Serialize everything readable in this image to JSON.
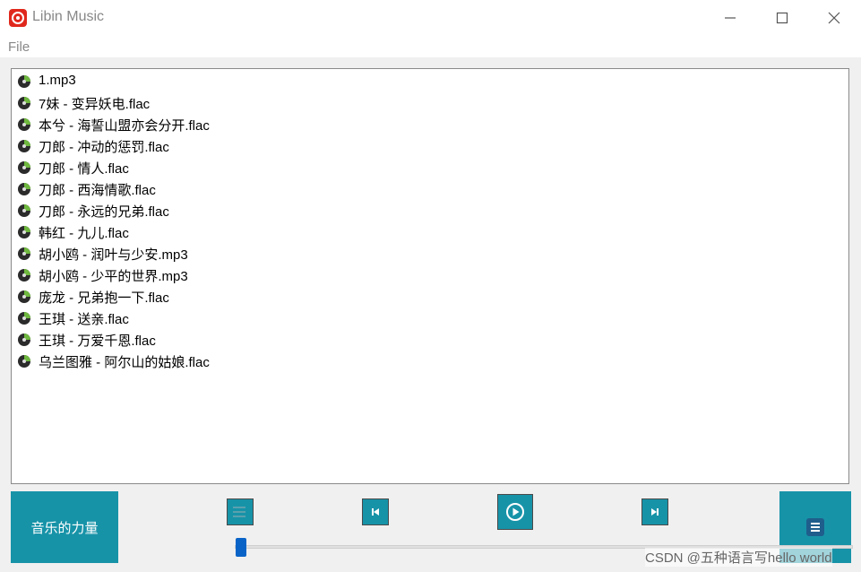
{
  "window": {
    "title": "Libin Music",
    "app_icon": "netease-music-icon"
  },
  "window_controls": {
    "minimize": "minimize-icon",
    "maximize": "maximize-icon",
    "close": "close-icon"
  },
  "menu": {
    "file_label": "File"
  },
  "playlist": {
    "tracks": [
      "1.mp3",
      "7妹 - 变异妖电.flac",
      "本兮 - 海誓山盟亦会分开.flac",
      "刀郎 - 冲动的惩罚.flac",
      "刀郎 - 情人.flac",
      "刀郎 - 西海情歌.flac",
      "刀郎 - 永远的兄弟.flac",
      "韩红 - 九儿.flac",
      "胡小鸥 - 润叶与少安.mp3",
      "胡小鸥 - 少平的世界.mp3",
      "庞龙 - 兄弟抱一下.flac",
      "王琪 - 送亲.flac",
      "王琪 - 万爱千恩.flac",
      "乌兰图雅 - 阿尔山的姑娘.flac"
    ],
    "track_icon": "music-disc-icon"
  },
  "brand_panel": {
    "label": "音乐的力量"
  },
  "controls": {
    "mode_icon": "playlist-mode-icon",
    "prev_icon": "previous-icon",
    "play_icon": "play-icon",
    "next_icon": "next-icon",
    "menu_icon": "menu-icon"
  },
  "progress": {
    "value": 0.0
  },
  "watermark": {
    "text": "CSDN @五种语言写hello world"
  },
  "colors": {
    "accent": "#1793a8",
    "slider": "#0a64c8",
    "app_icon_bg": "#e0271c"
  }
}
